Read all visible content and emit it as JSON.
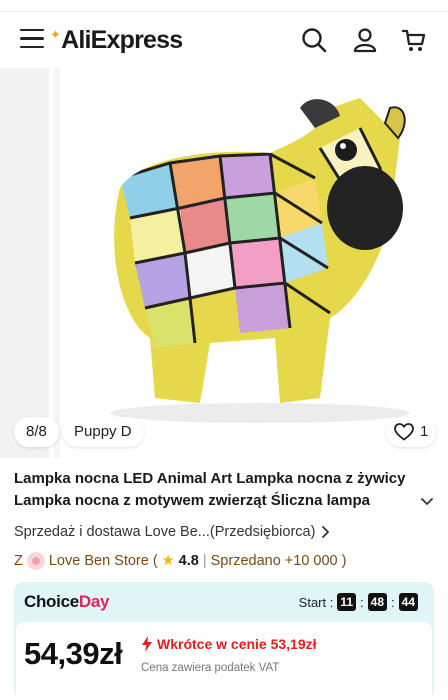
{
  "header": {
    "logo_text": "AliExpress",
    "icons": [
      "menu-icon",
      "search-icon",
      "account-icon",
      "cart-icon"
    ]
  },
  "gallery": {
    "counter": "8/8",
    "variant_label": "Puppy D",
    "likes": "1",
    "image_subject": "mosaic pug dog lamp"
  },
  "product": {
    "title": "Lampka nocna LED Animal Art Lampka nocna z żywicy Lampka nocna z motywem zwierząt Śliczna lampa"
  },
  "seller": {
    "line": "Sprzedaż i dostawa Love Be...(Przedsiębiorca)"
  },
  "store": {
    "prefix": "Z",
    "name": "Love Ben Store",
    "open_paren": "(",
    "rating": "4.8",
    "separator": "|",
    "sold": "Sprzedano +10 000",
    "close_paren": ")"
  },
  "choice": {
    "logo_part1": "Choice",
    "logo_part2": "Day",
    "start_label": "Start :",
    "hours": "11",
    "minutes": "48",
    "seconds": "44",
    "colon": ":",
    "price": "54,39zł",
    "promo": "Wkrótce w cenie 53,19zł",
    "vat": "Cena zawiera podatek VAT"
  },
  "colors": {
    "brand_red": "#e2245c",
    "promo_red": "#e0201d",
    "choice_bg": "#dff5f6",
    "logo_star": "#f7a500"
  }
}
